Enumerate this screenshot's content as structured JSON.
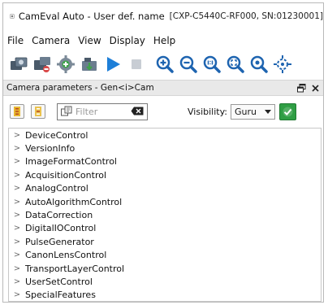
{
  "window": {
    "title": "CamEval Auto -  User def. name",
    "subtitle": "[CXP-C5440C-RF000, SN:01230001]"
  },
  "menu": [
    "File",
    "Camera",
    "View",
    "Display",
    "Help"
  ],
  "toolbar": {
    "buttons": [
      "cameras-icon",
      "camera-settings-icon",
      "gear-add-icon",
      "grab-icon",
      "play-icon",
      "stop-icon",
      "zoom-in-icon",
      "zoom-out-icon",
      "zoom-1to1-icon",
      "zoom-fit-icon",
      "zoom-custom-icon",
      "crosshair-icon"
    ]
  },
  "panel": {
    "title": "Camera parameters - Gen<i>Cam",
    "filter_placeholder": "Filter",
    "filter_value": "",
    "visibility_label": "Visibility:",
    "visibility_value": "Guru"
  },
  "tree": {
    "items": [
      "DeviceControl",
      "VersionInfo",
      "ImageFormatControl",
      "AcquisitionControl",
      "AnalogControl",
      "AutoAlgorithmControl",
      "DataCorrection",
      "DigitalIOControl",
      "PulseGenerator",
      "CanonLensControl",
      "TransportLayerControl",
      "UserSetControl",
      "SpecialFeatures"
    ],
    "expander": ">"
  },
  "colors": {
    "accent": "#1e64b0",
    "ok": "#2f9e44"
  }
}
